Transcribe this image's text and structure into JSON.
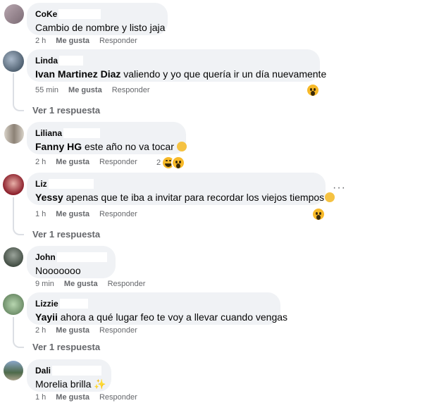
{
  "actions": {
    "like": "Me gusta",
    "reply": "Responder"
  },
  "comments": [
    {
      "name": "CoKe",
      "text": "Cambio de nombre y listo jaja",
      "time": "2 h"
    },
    {
      "name": "Linda",
      "mention": "Ivan Martinez Diaz",
      "text": " valiendo y yo que quería ir un día nuevamente",
      "time": "55 min",
      "replies": "Ver 1 respuesta",
      "reactions": [
        "wow-icon"
      ]
    },
    {
      "name": "Liliana",
      "mention": "Fanny HG",
      "text": " este año no va tocar",
      "time": "2 h",
      "reaction_count": "2",
      "reactions": [
        "haha-icon",
        "wow-icon"
      ]
    },
    {
      "name": "Liz",
      "mention": "Yessy",
      "text": " apenas que te iba a invitar para recordar los viejos tiempos",
      "time": "1 h",
      "replies": "Ver 1 respuesta",
      "reactions": [
        "wow-icon"
      ]
    },
    {
      "name": "John",
      "text": "Nooooooo",
      "time": "9 min"
    },
    {
      "name": "Lizzie",
      "mention": "Yayii",
      "text": " ahora a qué lugar feo te voy a llevar cuando vengas",
      "time": "2 h",
      "replies": "Ver 1 respuesta"
    },
    {
      "name": "Dali",
      "text": "Morelia brilla",
      "time": "1 h"
    }
  ],
  "colors": {
    "bubble": "#f0f2f5",
    "meta": "#65676b",
    "reaction": "#f7b928"
  }
}
